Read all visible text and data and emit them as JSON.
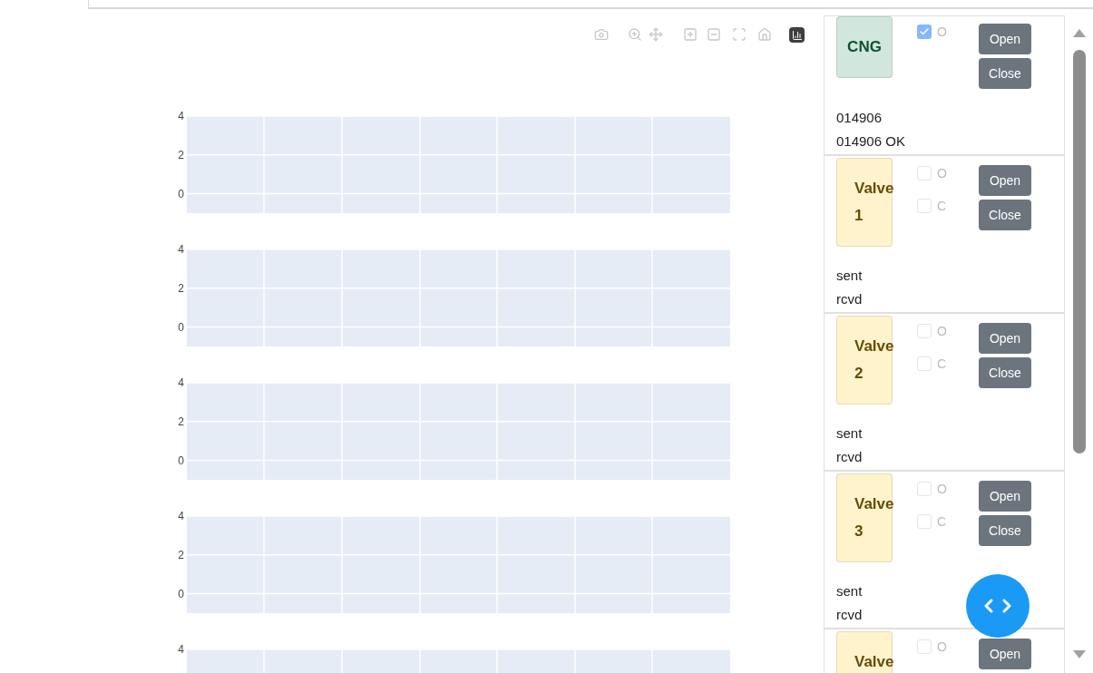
{
  "toolbar": {
    "buttons": [
      {
        "kind": "camera"
      },
      {
        "kind": "zoom"
      },
      {
        "kind": "pan"
      },
      {
        "kind": "zoom-in"
      },
      {
        "kind": "zoom-out"
      },
      {
        "kind": "autoscale"
      },
      {
        "kind": "home"
      },
      {
        "kind": "logo"
      }
    ]
  },
  "plots": [
    {
      "yticks": [
        "4",
        "2",
        "0"
      ]
    },
    {
      "yticks": [
        "4",
        "2",
        "0"
      ]
    },
    {
      "yticks": [
        "4",
        "2",
        "0"
      ]
    },
    {
      "yticks": [
        "4",
        "2",
        "0"
      ]
    },
    {
      "yticks": [
        "4"
      ]
    }
  ],
  "devices": [
    {
      "label": "CNG",
      "color": "#d1e7dd",
      "checks": [
        {
          "label": "O",
          "checked": true
        }
      ],
      "buttons": [
        "Open",
        "Close"
      ],
      "lines": [
        "014906",
        "014906 OK"
      ]
    },
    {
      "label": "Valve 1",
      "color": "#fff3cd",
      "checks": [
        {
          "label": "O",
          "checked": false
        },
        {
          "label": "C",
          "checked": false
        }
      ],
      "buttons": [
        "Open",
        "Close"
      ],
      "lines": [
        "sent",
        "rcvd"
      ]
    },
    {
      "label": "Valve 2",
      "color": "#fff3cd",
      "checks": [
        {
          "label": "O",
          "checked": false
        },
        {
          "label": "C",
          "checked": false
        }
      ],
      "buttons": [
        "Open",
        "Close"
      ],
      "lines": [
        "sent",
        "rcvd"
      ]
    },
    {
      "label": "Valve 3",
      "color": "#fff3cd",
      "checks": [
        {
          "label": "O",
          "checked": false
        },
        {
          "label": "C",
          "checked": false
        }
      ],
      "buttons": [
        "Open",
        "Close"
      ],
      "lines": [
        "sent",
        "rcvd"
      ]
    },
    {
      "label": "Valve",
      "color": "#fff3cd",
      "checks": [
        {
          "label": "O",
          "checked": false
        }
      ],
      "buttons": [
        "Open"
      ]
    }
  ]
}
